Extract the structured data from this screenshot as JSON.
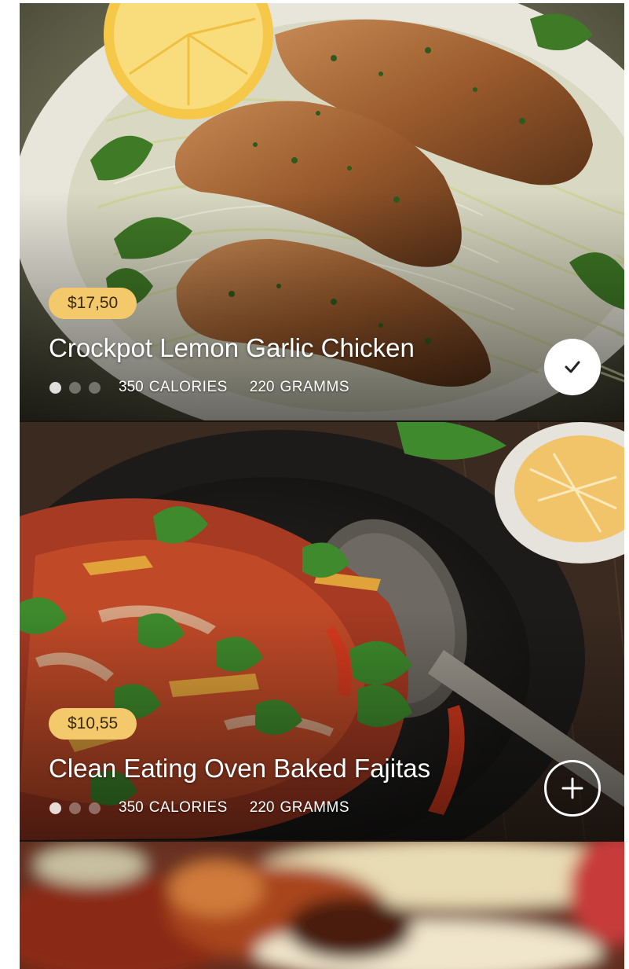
{
  "colors": {
    "price_badge_bg": "#f4c96b",
    "price_badge_text": "#3a2a10",
    "text": "#ffffff"
  },
  "meals": [
    {
      "price": "$17,50",
      "title": "Crockpot Lemon Garlic Chicken",
      "calories_value": "350",
      "calories_unit": "CALORIES",
      "weight_value": "220",
      "weight_unit": "GRAMMS",
      "rating_dots_filled": 1,
      "rating_dots_total": 3,
      "action_icon": "check-icon",
      "selected": true
    },
    {
      "price": "$10,55",
      "title": "Clean Eating Oven Baked Fajitas",
      "calories_value": "350",
      "calories_unit": "CALORIES",
      "weight_value": "220",
      "weight_unit": "GRAMMS",
      "rating_dots_filled": 1,
      "rating_dots_total": 3,
      "action_icon": "plus-icon",
      "selected": false
    }
  ]
}
